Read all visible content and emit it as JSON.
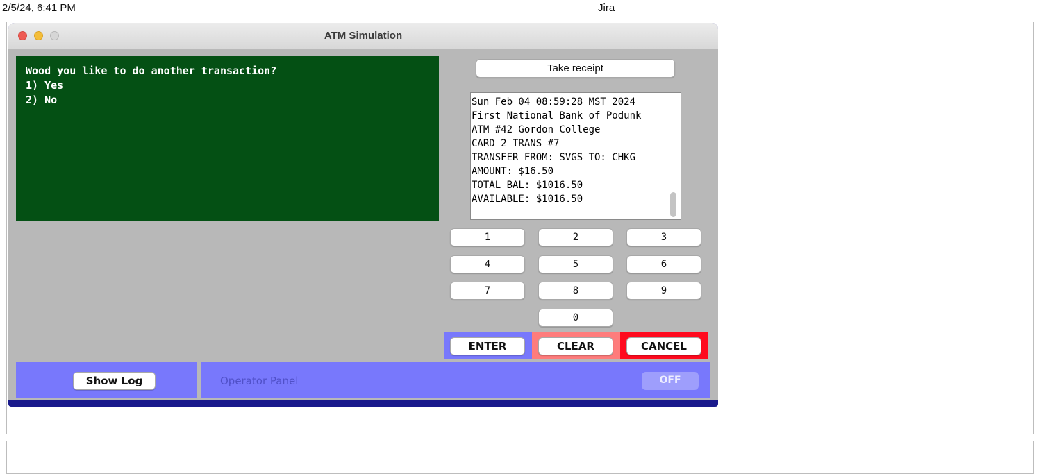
{
  "print_header": {
    "timestamp": "2/5/24, 6:41 PM",
    "page_title": "Jira"
  },
  "window": {
    "title": "ATM Simulation"
  },
  "display": {
    "lines": [
      "Wood you like to do another transaction?",
      "1) Yes",
      "2) No"
    ]
  },
  "receipt": {
    "button_label": "Take receipt",
    "lines": [
      "Sun Feb 04 08:59:28 MST 2024",
      "First National Bank of Podunk",
      "ATM #42 Gordon College",
      "CARD 2 TRANS #7",
      "TRANSFER FROM: SVGS TO: CHKG",
      "AMOUNT: $16.50",
      "TOTAL BAL: $1016.50",
      "AVAILABLE: $1016.50"
    ]
  },
  "keypad": {
    "keys": [
      "1",
      "2",
      "3",
      "4",
      "5",
      "6",
      "7",
      "8",
      "9",
      "0"
    ]
  },
  "function_keys": {
    "enter": "ENTER",
    "clear": "CLEAR",
    "cancel": "CANCEL"
  },
  "log": {
    "button_label": "Show Log"
  },
  "operator_panel": {
    "label": "Operator Panel",
    "switch_label": "OFF"
  },
  "colors": {
    "screen_bg": "#045014",
    "panel_blue": "#7878fc",
    "clear_bg": "#fe7c7c",
    "cancel_bg": "#ff0a1e",
    "window_bg": "#b8b8b8"
  }
}
